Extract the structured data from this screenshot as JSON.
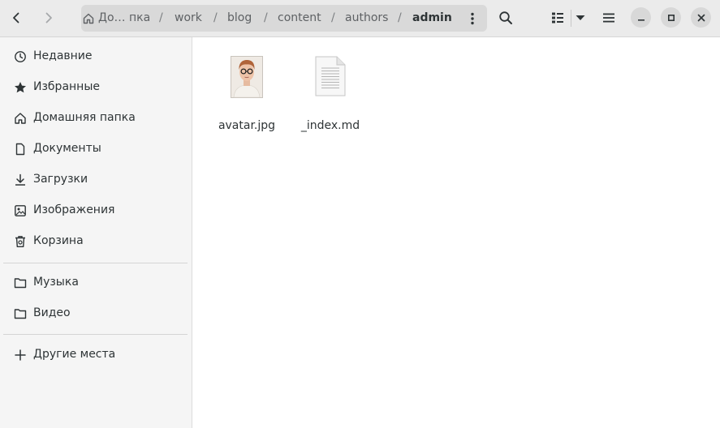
{
  "pathbar": {
    "crumbs": [
      "До… пка",
      "work",
      "blog",
      "content",
      "authors",
      "admin"
    ],
    "separator": "/"
  },
  "sidebar": {
    "items": [
      {
        "label": "Недавние",
        "icon": "clock-icon"
      },
      {
        "label": "Избранные",
        "icon": "star-icon"
      },
      {
        "label": "Домашняя папка",
        "icon": "home-icon"
      },
      {
        "label": "Документы",
        "icon": "document-icon"
      },
      {
        "label": "Загрузки",
        "icon": "download-icon"
      },
      {
        "label": "Изображения",
        "icon": "image-icon"
      },
      {
        "label": "Корзина",
        "icon": "trash-icon"
      },
      {
        "label": "Музыка",
        "icon": "folder-icon"
      },
      {
        "label": "Видео",
        "icon": "folder-icon"
      },
      {
        "label": "Другие места",
        "icon": "plus-icon"
      }
    ]
  },
  "files": [
    {
      "name": "avatar.jpg",
      "icon": "image-thumbnail"
    },
    {
      "name": "_index.md",
      "icon": "text-file-icon"
    }
  ]
}
